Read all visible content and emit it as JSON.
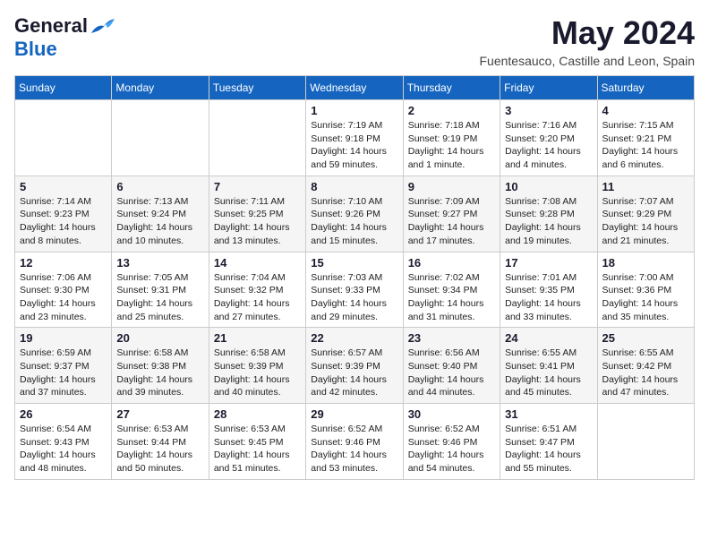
{
  "logo": {
    "general": "General",
    "blue": "Blue"
  },
  "header": {
    "month_title": "May 2024",
    "subtitle": "Fuentesauco, Castille and Leon, Spain"
  },
  "days_of_week": [
    "Sunday",
    "Monday",
    "Tuesday",
    "Wednesday",
    "Thursday",
    "Friday",
    "Saturday"
  ],
  "weeks": [
    [
      {
        "day": "",
        "info": ""
      },
      {
        "day": "",
        "info": ""
      },
      {
        "day": "",
        "info": ""
      },
      {
        "day": "1",
        "info": "Sunrise: 7:19 AM\nSunset: 9:18 PM\nDaylight: 14 hours\nand 59 minutes."
      },
      {
        "day": "2",
        "info": "Sunrise: 7:18 AM\nSunset: 9:19 PM\nDaylight: 14 hours\nand 1 minute."
      },
      {
        "day": "3",
        "info": "Sunrise: 7:16 AM\nSunset: 9:20 PM\nDaylight: 14 hours\nand 4 minutes."
      },
      {
        "day": "4",
        "info": "Sunrise: 7:15 AM\nSunset: 9:21 PM\nDaylight: 14 hours\nand 6 minutes."
      }
    ],
    [
      {
        "day": "5",
        "info": "Sunrise: 7:14 AM\nSunset: 9:23 PM\nDaylight: 14 hours\nand 8 minutes."
      },
      {
        "day": "6",
        "info": "Sunrise: 7:13 AM\nSunset: 9:24 PM\nDaylight: 14 hours\nand 10 minutes."
      },
      {
        "day": "7",
        "info": "Sunrise: 7:11 AM\nSunset: 9:25 PM\nDaylight: 14 hours\nand 13 minutes."
      },
      {
        "day": "8",
        "info": "Sunrise: 7:10 AM\nSunset: 9:26 PM\nDaylight: 14 hours\nand 15 minutes."
      },
      {
        "day": "9",
        "info": "Sunrise: 7:09 AM\nSunset: 9:27 PM\nDaylight: 14 hours\nand 17 minutes."
      },
      {
        "day": "10",
        "info": "Sunrise: 7:08 AM\nSunset: 9:28 PM\nDaylight: 14 hours\nand 19 minutes."
      },
      {
        "day": "11",
        "info": "Sunrise: 7:07 AM\nSunset: 9:29 PM\nDaylight: 14 hours\nand 21 minutes."
      }
    ],
    [
      {
        "day": "12",
        "info": "Sunrise: 7:06 AM\nSunset: 9:30 PM\nDaylight: 14 hours\nand 23 minutes."
      },
      {
        "day": "13",
        "info": "Sunrise: 7:05 AM\nSunset: 9:31 PM\nDaylight: 14 hours\nand 25 minutes."
      },
      {
        "day": "14",
        "info": "Sunrise: 7:04 AM\nSunset: 9:32 PM\nDaylight: 14 hours\nand 27 minutes."
      },
      {
        "day": "15",
        "info": "Sunrise: 7:03 AM\nSunset: 9:33 PM\nDaylight: 14 hours\nand 29 minutes."
      },
      {
        "day": "16",
        "info": "Sunrise: 7:02 AM\nSunset: 9:34 PM\nDaylight: 14 hours\nand 31 minutes."
      },
      {
        "day": "17",
        "info": "Sunrise: 7:01 AM\nSunset: 9:35 PM\nDaylight: 14 hours\nand 33 minutes."
      },
      {
        "day": "18",
        "info": "Sunrise: 7:00 AM\nSunset: 9:36 PM\nDaylight: 14 hours\nand 35 minutes."
      }
    ],
    [
      {
        "day": "19",
        "info": "Sunrise: 6:59 AM\nSunset: 9:37 PM\nDaylight: 14 hours\nand 37 minutes."
      },
      {
        "day": "20",
        "info": "Sunrise: 6:58 AM\nSunset: 9:38 PM\nDaylight: 14 hours\nand 39 minutes."
      },
      {
        "day": "21",
        "info": "Sunrise: 6:58 AM\nSunset: 9:39 PM\nDaylight: 14 hours\nand 40 minutes."
      },
      {
        "day": "22",
        "info": "Sunrise: 6:57 AM\nSunset: 9:39 PM\nDaylight: 14 hours\nand 42 minutes."
      },
      {
        "day": "23",
        "info": "Sunrise: 6:56 AM\nSunset: 9:40 PM\nDaylight: 14 hours\nand 44 minutes."
      },
      {
        "day": "24",
        "info": "Sunrise: 6:55 AM\nSunset: 9:41 PM\nDaylight: 14 hours\nand 45 minutes."
      },
      {
        "day": "25",
        "info": "Sunrise: 6:55 AM\nSunset: 9:42 PM\nDaylight: 14 hours\nand 47 minutes."
      }
    ],
    [
      {
        "day": "26",
        "info": "Sunrise: 6:54 AM\nSunset: 9:43 PM\nDaylight: 14 hours\nand 48 minutes."
      },
      {
        "day": "27",
        "info": "Sunrise: 6:53 AM\nSunset: 9:44 PM\nDaylight: 14 hours\nand 50 minutes."
      },
      {
        "day": "28",
        "info": "Sunrise: 6:53 AM\nSunset: 9:45 PM\nDaylight: 14 hours\nand 51 minutes."
      },
      {
        "day": "29",
        "info": "Sunrise: 6:52 AM\nSunset: 9:46 PM\nDaylight: 14 hours\nand 53 minutes."
      },
      {
        "day": "30",
        "info": "Sunrise: 6:52 AM\nSunset: 9:46 PM\nDaylight: 14 hours\nand 54 minutes."
      },
      {
        "day": "31",
        "info": "Sunrise: 6:51 AM\nSunset: 9:47 PM\nDaylight: 14 hours\nand 55 minutes."
      },
      {
        "day": "",
        "info": ""
      }
    ]
  ]
}
